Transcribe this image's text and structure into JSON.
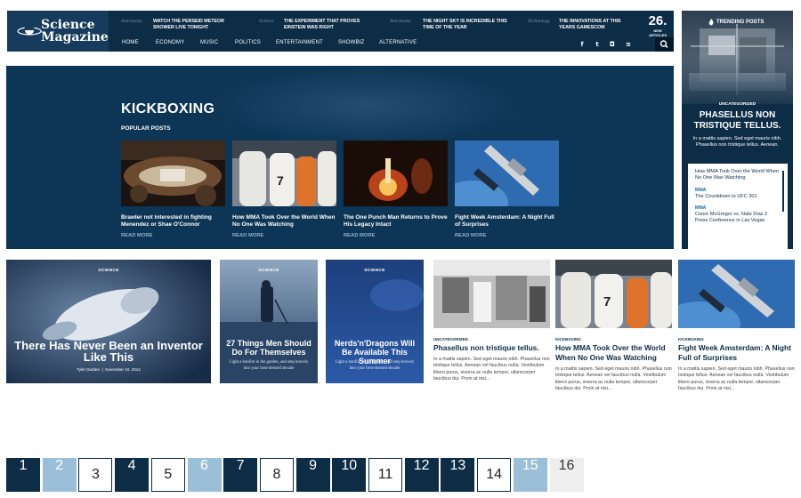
{
  "logo": {
    "line1": "Science",
    "line2": "Magazine"
  },
  "ticker": [
    {
      "category": "Astronomy",
      "text": "Watch the Perseid Meteor Shower Live Tonight"
    },
    {
      "category": "Science",
      "text": "The Experiment That Proves Einstein Was Right"
    },
    {
      "category": "Astronomy",
      "text": "The Night Sky Is Incredible This Time of the Year"
    },
    {
      "category": "Technology",
      "text": "The Innovations at This Years Gamescom"
    }
  ],
  "counter": {
    "number": "26.",
    "label": "NEW ARTICLES"
  },
  "nav": [
    "HOME",
    "ECONOMY",
    "MUSIC",
    "POLITICS",
    "ENTERTAINMENT",
    "SHOWBIZ",
    "ALTERNATIVE"
  ],
  "social_icons": [
    "facebook-icon",
    "twitter-icon",
    "instagram-icon",
    "rss-icon"
  ],
  "social_glyphs": [
    "f",
    "t",
    "◘",
    "≋"
  ],
  "trending": {
    "title": "TRENDING POSTS",
    "category": "UNCATEGORIZED",
    "headline": "PHASELLUS NON TRISTIQUE TELLUS.",
    "excerpt": "In a mattis sapien. Sed eget mauris nibh. Phasellus non tristique tellus. Aenean.",
    "list": [
      {
        "category": "",
        "title": "How MMA Took Over the World When No One Was Watching"
      },
      {
        "category": "MMA",
        "title": "The Countdown to UFC 201"
      },
      {
        "category": "MMA",
        "title": "Conor McGregor vs. Nate Diaz 2 Press Conference in Las Vegas"
      }
    ]
  },
  "banner": {
    "title": "KICKBOXING",
    "subtitle": "POPULAR POSTS",
    "read_more": "READ MORE",
    "posts": [
      {
        "title": "Brawler not interested in fighting Menendez or Shae O'Connor"
      },
      {
        "title": "How MMA Took Over the World When No One Was Watching"
      },
      {
        "title": "The One Punch Man Returns to Prove His Legacy Intact"
      },
      {
        "title": "Fight Week Amsterdam: A Night Full of Surprises"
      }
    ]
  },
  "big_cards": [
    {
      "category": "SCIENCE",
      "title": "There Has Never Been an Inventor Like This",
      "author": "Tyler Durden",
      "date": "November 10, 2014"
    },
    {
      "category": "SCIENCE",
      "title": "27 Things Men Should Do For Themselves",
      "excerpt": "Light a bonfire in the garden, and step bravely into your best-dressed decade"
    },
    {
      "category": "SCIENCE",
      "title": "Nerds'n'Dragons Will Be Available This Summer",
      "excerpt": "Light a bonfire in the garden, and step bravely into your best-dressed decade"
    }
  ],
  "text_cards": [
    {
      "category": "UNCATEGORIZED",
      "title": "Phasellus non tristique tellus.",
      "excerpt": "In a mattis sapien. Sed eget mauris nibh. Phasellus non tristique tellus. Aenean vel faucibus nulla. Vestibulum libero purus, viverra ac nulla tempor, ullamcorper faucibus dui. Proin at nisi..."
    },
    {
      "category": "KICKBOXING",
      "title": "How MMA Took Over the World When No One Was Watching",
      "excerpt": "In a mattis sapien. Sed eget mauris nibh. Phasellus non tristique tellus. Aenean vel faucibus nulla. Vestibulum libero purus, viverra ac nulla tempor, ullamcorper faucibus dui. Proin at nisi..."
    },
    {
      "category": "KICKBOXING",
      "title": "Fight Week Amsterdam: A Night Full of Surprises",
      "excerpt": "In a mattis sapien. Sed eget mauris nibh. Phasellus non tristique tellus. Aenean vel faucibus nulla. Vestibulum libero purus, viverra ac nulla tempor, ullamcorper faucibus dui. Proin at nisi..."
    }
  ],
  "pagination": {
    "pages": [
      "1",
      "2",
      "3",
      "4",
      "5",
      "6",
      "7",
      "8",
      "9",
      "10",
      "11",
      "12",
      "13",
      "14",
      "15",
      "16"
    ],
    "styles": [
      "dark",
      "light",
      "plain",
      "dark",
      "plain",
      "light",
      "dark",
      "plain",
      "dark",
      "dark",
      "plain",
      "dark",
      "dark",
      "plain",
      "light",
      "grey"
    ]
  },
  "colors": {
    "navy": "#0d2c46",
    "accent_light": "#9bbfd9",
    "link_blue": "#1a6bb0"
  }
}
